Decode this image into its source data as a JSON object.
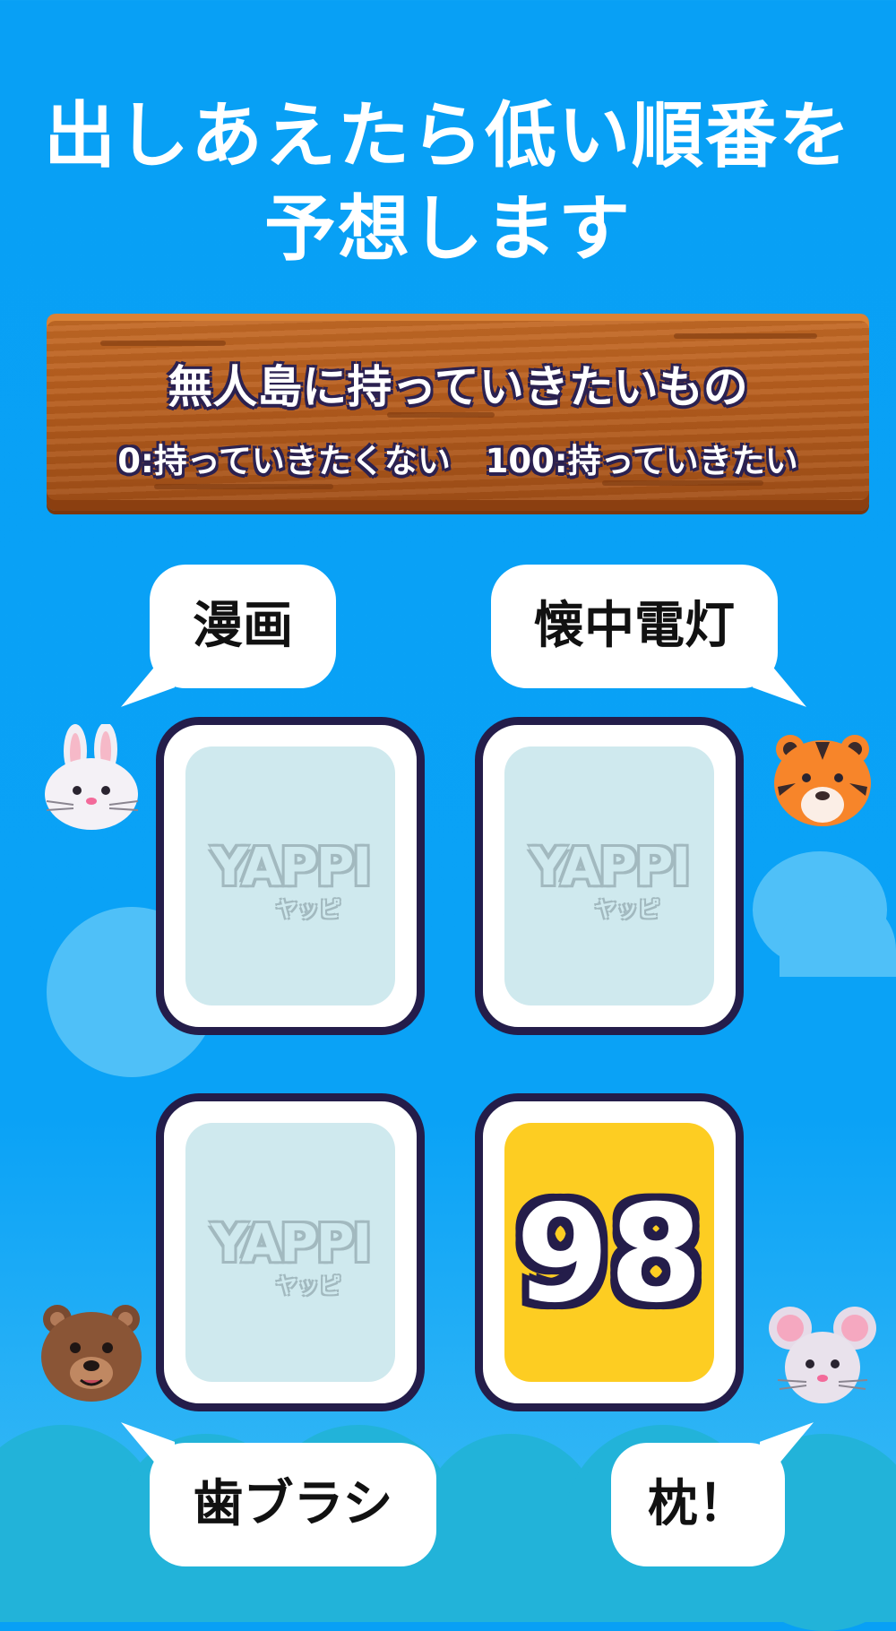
{
  "headline": {
    "line1": "出しあえたら低い順番を",
    "line2": "予想します"
  },
  "topic": {
    "title": "無人島に持っていきたいもの",
    "scale": "0:持っていきたくない   100:持っていきたい"
  },
  "players": [
    {
      "id": "rabbit",
      "answer": "漫画"
    },
    {
      "id": "tiger",
      "answer": "懐中電灯"
    },
    {
      "id": "bear",
      "answer": "歯ブラシ"
    },
    {
      "id": "mouse",
      "answer": "枕！"
    }
  ],
  "cards": {
    "logo": "YAPPI",
    "logo_sub": "ヤッピ",
    "revealed_number": "98"
  },
  "colors": {
    "background": "#0aa2f6",
    "card_outline": "#241d4a",
    "card_back": "#cfe9ee",
    "card_revealed": "#fdcd22",
    "board_wood": "#b65d1d"
  },
  "icons": [
    "rabbit-avatar-icon",
    "tiger-avatar-icon",
    "bear-avatar-icon",
    "mouse-avatar-icon"
  ]
}
